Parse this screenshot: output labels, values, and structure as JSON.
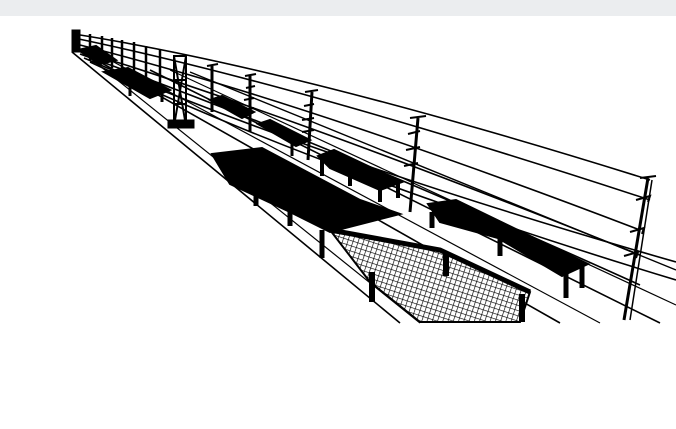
{
  "viewport": {
    "background": "#ffffff",
    "top_bar_color": "#ebedef",
    "model_icon": "wireframe-rail-catenary-model",
    "line_color": "#000000",
    "mesh_color": "#000000"
  }
}
